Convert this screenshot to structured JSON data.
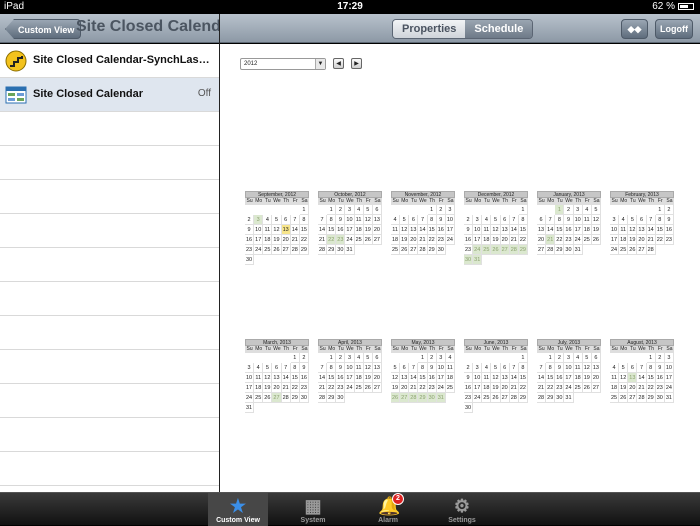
{
  "status": {
    "carrier": "iPad",
    "time": "17:29",
    "battery": "62 %"
  },
  "left_nav": {
    "back": "Custom View",
    "title": "Site Closed Calendar"
  },
  "right_nav": {
    "tab_properties": "Properties",
    "tab_schedule": "Schedule",
    "swap": "◆◆",
    "logoff": "Logoff"
  },
  "list": [
    {
      "label": "Site Closed Calendar-SynchLastM...",
      "value": ""
    },
    {
      "label": "Site Closed Calendar",
      "value": "Off"
    }
  ],
  "calendar": {
    "year": "2012",
    "prev": "◀",
    "next": "▶",
    "weekdays": [
      "Su",
      "Mo",
      "Tu",
      "We",
      "Th",
      "Fr",
      "Sa"
    ],
    "months": [
      {
        "name": "September, 2012",
        "start": 6,
        "days": 30,
        "green": [
          3
        ],
        "yellow": [
          13
        ]
      },
      {
        "name": "October, 2012",
        "start": 1,
        "days": 31,
        "green": [
          22,
          23
        ],
        "yellow": []
      },
      {
        "name": "November, 2012",
        "start": 4,
        "days": 30,
        "green": [],
        "yellow": []
      },
      {
        "name": "December, 2012",
        "start": 6,
        "days": 31,
        "green": [
          24,
          25,
          26,
          27,
          28,
          29,
          30,
          31
        ],
        "yellow": []
      },
      {
        "name": "January, 2013",
        "start": 2,
        "days": 31,
        "green": [
          1,
          21
        ],
        "yellow": []
      },
      {
        "name": "February, 2013",
        "start": 5,
        "days": 28,
        "green": [],
        "yellow": []
      },
      {
        "name": "March, 2013",
        "start": 5,
        "days": 31,
        "green": [
          27
        ],
        "yellow": []
      },
      {
        "name": "April, 2013",
        "start": 1,
        "days": 30,
        "green": [],
        "yellow": []
      },
      {
        "name": "May, 2013",
        "start": 3,
        "days": 31,
        "green": [
          26,
          27,
          28,
          29,
          30,
          31
        ],
        "yellow": []
      },
      {
        "name": "June, 2013",
        "start": 6,
        "days": 30,
        "green": [],
        "yellow": []
      },
      {
        "name": "July, 2013",
        "start": 1,
        "days": 31,
        "green": [],
        "yellow": []
      },
      {
        "name": "August, 2013",
        "start": 4,
        "days": 31,
        "green": [
          13
        ],
        "yellow": []
      }
    ]
  },
  "tabs": [
    {
      "label": "Custom View",
      "icon": "star-icon",
      "glyph": "★",
      "active": true
    },
    {
      "label": "System",
      "icon": "building-icon",
      "glyph": "▦",
      "active": false
    },
    {
      "label": "Alarm",
      "icon": "bell-icon",
      "glyph": "🔔",
      "active": false,
      "badge": "2"
    },
    {
      "label": "Settings",
      "icon": "gear-icon",
      "glyph": "⚙",
      "active": false
    }
  ]
}
